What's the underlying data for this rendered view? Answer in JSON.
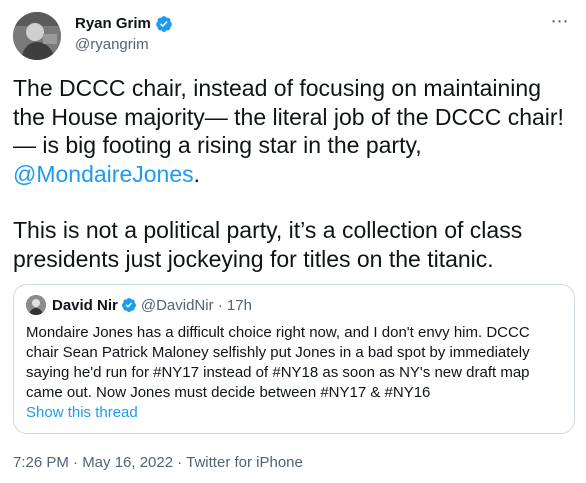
{
  "author": {
    "name": "Ryan Grim",
    "handle": "@ryangrim"
  },
  "tweet": {
    "paragraph1_text": "The DCCC chair, instead of focusing on maintaining the House majority— the literal job of the DCCC chair! — is big footing a rising star in the party,",
    "mention": "@MondaireJones",
    "paragraph1_end": ".",
    "paragraph2": "This is not a political party, it’s a collection of class presidents just jockeying for titles on the titanic."
  },
  "quote": {
    "name": "David Nir",
    "handle_time": "@DavidNir · 17h",
    "text": "Mondaire Jones has a difficult choice right now, and I don't envy him. DCCC chair Sean Patrick Maloney selfishly put Jones in a bad spot by immediately saying he'd run for #NY17 instead of #NY18 as soon as NY's new draft map came out. Now Jones must decide between #NY17 & #NY16",
    "show_thread": "Show this thread"
  },
  "meta": {
    "timestamp": "7:26 PM · May 16, 2022 · Twitter for iPhone"
  },
  "icons": {
    "more": "more-options-icon",
    "verified": "verified-badge-icon"
  },
  "colors": {
    "accent": "#1d9bf0",
    "secondary_text": "#536471",
    "border": "#cfd9de"
  }
}
